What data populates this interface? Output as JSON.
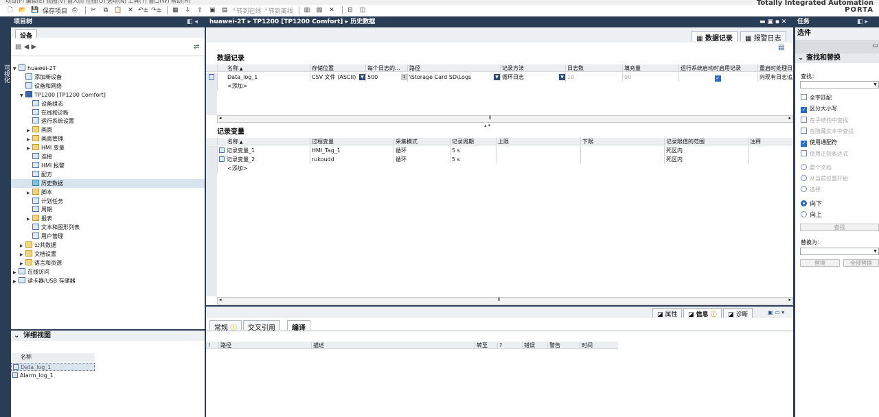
{
  "brand": {
    "line1": "Totally Integrated Automation",
    "line2": "PORTA"
  },
  "toolbar": {
    "save_label": "保存项目",
    "go_online": "转到在线",
    "go_offline": "转到离线"
  },
  "project_tree": {
    "title": "项目树",
    "tab": "设备",
    "sidebar_label": "可视化",
    "items": [
      {
        "label": "huawei-2T",
        "icon": "project-icon"
      },
      {
        "label": "添加新设备",
        "icon": "add-device-icon"
      },
      {
        "label": "设备和网络",
        "icon": "network-icon"
      },
      {
        "label": "TP1200 [TP1200 Comfort]",
        "icon": "hmi-device-icon"
      },
      {
        "label": "设备组态",
        "icon": "device-config-icon"
      },
      {
        "label": "在线和诊断",
        "icon": "diagnostics-icon"
      },
      {
        "label": "运行系统设置",
        "icon": "runtime-settings-icon"
      },
      {
        "label": "画面",
        "icon": "folder-icon"
      },
      {
        "label": "画面管理",
        "icon": "folder-icon"
      },
      {
        "label": "HMI 变量",
        "icon": "folder-icon"
      },
      {
        "label": "连接",
        "icon": "connection-icon"
      },
      {
        "label": "HMI 报警",
        "icon": "alarm-icon"
      },
      {
        "label": "配方",
        "icon": "recipe-icon"
      },
      {
        "label": "历史数据",
        "icon": "historical-data-icon"
      },
      {
        "label": "脚本",
        "icon": "folder-icon"
      },
      {
        "label": "计划任务",
        "icon": "task-icon"
      },
      {
        "label": "周期",
        "icon": "cycle-icon"
      },
      {
        "label": "报表",
        "icon": "folder-icon"
      },
      {
        "label": "文本和图形列表",
        "icon": "list-icon"
      },
      {
        "label": "用户管理",
        "icon": "user-icon"
      },
      {
        "label": "公共数据",
        "icon": "folder-icon"
      },
      {
        "label": "文档设置",
        "icon": "folder-icon"
      },
      {
        "label": "语言和资源",
        "icon": "folder-icon"
      },
      {
        "label": "在线访问",
        "icon": "online-icon"
      },
      {
        "label": "读卡器/USB 存储器",
        "icon": "usb-icon"
      }
    ]
  },
  "detail_view": {
    "title": "详细视图",
    "col": "名称",
    "items": [
      "Data_log_1",
      "Alarm_log_1"
    ]
  },
  "editor": {
    "breadcrumb": [
      "huawei-2T",
      "TP1200 [TP1200 Comfort]",
      "历史数据"
    ],
    "tabs": {
      "data_log": "数据记录",
      "alarm_log": "报警日志"
    },
    "data_log_section": "数据记录",
    "data_log_headers": [
      "名称",
      "存储位置",
      "每个日志的...",
      "路径",
      "记录方法",
      "日志数",
      "填充量",
      "运行系统启动时启用记录",
      "重启时处理日"
    ],
    "data_log_row": {
      "name": "Data_log_1",
      "storage": "CSV 文件 (ASCII)",
      "per_log": "500",
      "path": "\\Storage Card SD\\Logs",
      "method": "循环日志",
      "count": "10",
      "fill": "90",
      "enable": true,
      "restart": "向现有日志追加"
    },
    "add_label": "<添加>",
    "tags_section": "记录变量",
    "tags_headers": [
      "名称",
      "过程变量",
      "采集模式",
      "记录周期",
      "上限",
      "下限",
      "记录限值的范围",
      "注释"
    ],
    "tags_rows": [
      {
        "name": "记录变量_1",
        "tag": "HMI_Tag_1",
        "mode": "循环",
        "cycle": "5 s",
        "range": "死区内"
      },
      {
        "name": "记录变量_2",
        "tag": "rukoudd",
        "mode": "循环",
        "cycle": "5 s",
        "range": "死区内"
      }
    ]
  },
  "inspector": {
    "tabs": [
      "属性",
      "信息",
      "诊断"
    ],
    "subtabs": [
      "常规",
      "交叉引用",
      "编译"
    ],
    "headers": [
      "!",
      "路径",
      "描述",
      "转至",
      "?",
      "错误",
      "警告",
      "时间"
    ]
  },
  "tasks": {
    "title": "任务",
    "options": "选件",
    "section": "查找和替换",
    "find_label": "查找：",
    "checks": [
      {
        "label": "全字匹配",
        "on": false,
        "dis": false
      },
      {
        "label": "区分大小写",
        "on": true,
        "dis": false
      },
      {
        "label": "在子结构中查找",
        "on": false,
        "dis": true
      },
      {
        "label": "在隐藏文本中查找",
        "on": false,
        "dis": true
      },
      {
        "label": "使用通配符",
        "on": true,
        "dis": false
      },
      {
        "label": "使用正则表达式",
        "on": false,
        "dis": true
      }
    ],
    "scope": [
      {
        "label": "整个文档",
        "on": false,
        "dis": true
      },
      {
        "label": "从当前位置开始",
        "on": false,
        "dis": true
      },
      {
        "label": "选择",
        "on": false,
        "dis": true
      }
    ],
    "dir": [
      {
        "label": "向下",
        "on": true
      },
      {
        "label": "向上",
        "on": false
      }
    ],
    "find_btn": "查找",
    "replace_label": "替换为：",
    "replace_btn": "替换",
    "replace_all_btn": "全部替换"
  }
}
